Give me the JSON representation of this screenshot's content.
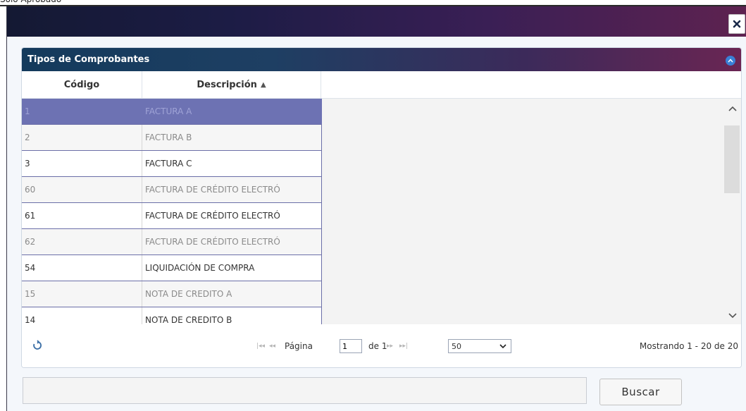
{
  "top_label": "Solo Aprobado",
  "panel": {
    "title": "Tipos de Comprobantes"
  },
  "columns": {
    "code": "Código",
    "description": "Descripción"
  },
  "rows": [
    {
      "code": "1",
      "description": "FACTURA A"
    },
    {
      "code": "2",
      "description": "FACTURA B"
    },
    {
      "code": "3",
      "description": "FACTURA C"
    },
    {
      "code": "60",
      "description": "FACTURA DE CRÉDITO ELECTRÓ"
    },
    {
      "code": "61",
      "description": "FACTURA DE CRÉDITO ELECTRÓ"
    },
    {
      "code": "62",
      "description": "FACTURA DE CRÉDITO ELECTRÓ"
    },
    {
      "code": "54",
      "description": "LIQUIDACIÓN DE COMPRA"
    },
    {
      "code": "15",
      "description": "NOTA DE CREDITO A"
    },
    {
      "code": "14",
      "description": "NOTA DE CREDITO B"
    }
  ],
  "pager": {
    "page_label": "Página",
    "page_value": "1",
    "of_label": "de 1",
    "page_size": "50",
    "status": "Mostrando 1 - 20 de 20"
  },
  "search": {
    "button_label": "Buscar"
  },
  "colors": {
    "selected_row": "#6d72b3",
    "title_gradient_start": "#141933",
    "title_gradient_end": "#5e2250"
  }
}
